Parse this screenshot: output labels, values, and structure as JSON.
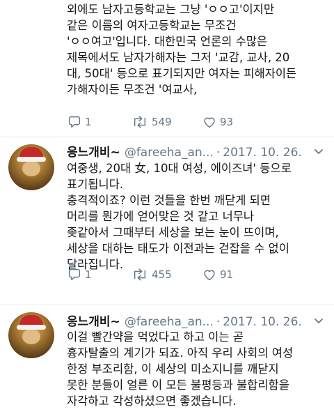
{
  "tweets": [
    {
      "lines": [
        "외에도 남자고등학교는 그냥 'ㅇㅇ고'이지만",
        "같은 이름의 여자고등학교는 무조건",
        "'ㅇㅇ여고'입니다. 대한민국 언론의 수많은",
        "제목에서도 남자가해자는 그저 '교감, 교사, 20",
        "대, 50대' 등으로 표기되지만 여자는 피해자이든",
        "가해자이든 무조건 '여교사,"
      ],
      "actions": {
        "reply_count": "1",
        "retweet_count": "549",
        "like_count": "93"
      }
    },
    {
      "author_name": "응느개비~",
      "author_handle": "@fareeha_an...",
      "separator": "·",
      "date": "2017. 10. 26.",
      "lines": [
        "여중생, 20대 女, 10대 여성, 에이즈녀' 등으로",
        "표기됩니다.",
        "충격적이죠? 이런 것들을 한번 깨닫게 되면",
        "머리를 뭔가에 얻어맞은 것 같고 너무나",
        "좆같아서 그때부터 세상을 보는 눈이 뜨이며,",
        "세상을 대하는 태도가 이전과는 걷잡을 수 없이",
        "달라집니다."
      ],
      "actions": {
        "reply_count": "1",
        "retweet_count": "455",
        "like_count": "91"
      }
    },
    {
      "author_name": "응느개비~",
      "author_handle": "@fareeha_an...",
      "separator": "·",
      "date": "2017. 10. 26.",
      "lines": [
        "이걸 빨간약을 먹었다고 하고 이는 곧",
        "흉자탈출의 계기가 되죠. 아직 우리 사회의 여성",
        "한정 부조리함, 이 세상의 미소지니를 깨닫지",
        "못한 분들이 얼른 이 모든 불평등과 불합리함을",
        "자각하고 각성하셨으면 좋겠습니다."
      ]
    }
  ],
  "icons": {
    "reply": "reply-icon",
    "retweet": "retweet-icon",
    "like": "like-icon",
    "more": "chevron-down-icon"
  },
  "colors": {
    "meta_gray": "#657786",
    "text": "#14171a",
    "divider": "#e1e8ed"
  }
}
